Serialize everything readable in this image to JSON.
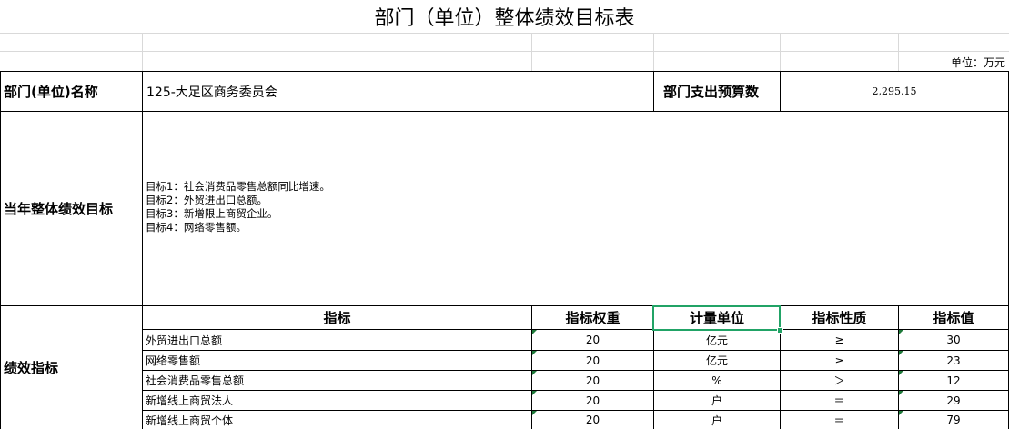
{
  "title": "部门（单位）整体绩效目标表",
  "unit_label": "单位：万元",
  "dept": {
    "label": "部门(单位)名称",
    "value": "125-大足区商务委员会",
    "budget_label": "部门支出预算数",
    "budget_value": "2,295.15"
  },
  "goals": {
    "label": "当年整体绩效目标",
    "lines": [
      "目标1：社会消费品零售总额同比增速。",
      "目标2：外贸进出口总额。",
      "目标3：新增限上商贸企业。",
      "目标4：网络零售额。"
    ]
  },
  "indicators": {
    "label": "绩效指标",
    "headers": {
      "name": "指标",
      "weight": "指标权重",
      "unit": "计量单位",
      "nature": "指标性质",
      "value": "指标值"
    },
    "rows": [
      {
        "name": "外贸进出口总额",
        "weight": "20",
        "unit": "亿元",
        "nature": "≥",
        "value": "30"
      },
      {
        "name": "网络零售额",
        "weight": "20",
        "unit": "亿元",
        "nature": "≥",
        "value": "23"
      },
      {
        "name": "社会消费品零售总额",
        "weight": "20",
        "unit": "%",
        "nature": "＞",
        "value": "12"
      },
      {
        "name": "新增线上商贸法人",
        "weight": "20",
        "unit": "户",
        "nature": "＝",
        "value": "29"
      },
      {
        "name": "新增线上商贸个体",
        "weight": "20",
        "unit": "户",
        "nature": "＝",
        "value": "79"
      }
    ]
  }
}
